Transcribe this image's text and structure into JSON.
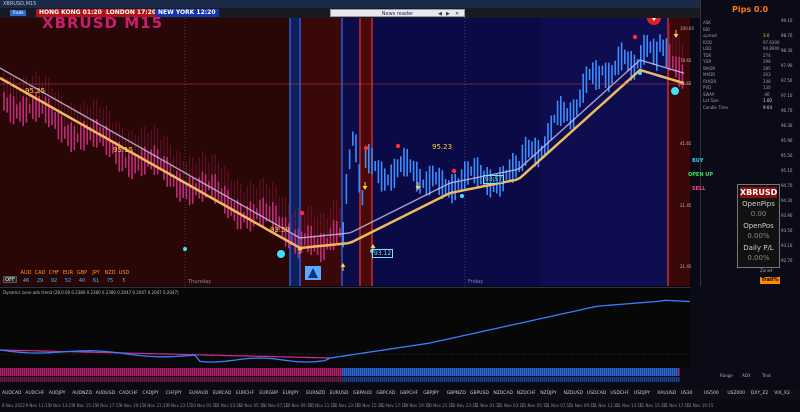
{
  "window": {
    "title": "XBRUSD,M15"
  },
  "toolbar": {
    "sessions": [
      {
        "label": "HONG KONG 01:20",
        "color": "#c41a1a"
      },
      {
        "label": "LONDON  17:20",
        "color": "#c41a1a"
      },
      {
        "label": "NEW YORK  12:20",
        "color": "#1a3ac4"
      }
    ],
    "news_label": "News reader",
    "trade_label": "Trade"
  },
  "chart": {
    "symbol_title": "XBRUSD M15",
    "price_scale": [
      "100.65",
      "78.65",
      "61.65",
      "41.65",
      "21.45",
      "21.45",
      "41.45",
      "61.65"
    ],
    "right_scale": [
      "99.10",
      "98.70",
      "98.30",
      "97.90",
      "97.50",
      "97.10",
      "96.70",
      "96.30",
      "95.90",
      "95.50",
      "95.10",
      "94.70",
      "94.30",
      "93.90",
      "93.50",
      "93.10",
      "92.70"
    ],
    "levels": [
      {
        "label": "95.25"
      },
      {
        "label": "95.15"
      },
      {
        "label": "95.23"
      },
      {
        "label": "93.59"
      },
      {
        "label": "93.57"
      },
      {
        "label": "93.12"
      }
    ],
    "days": [
      "Thursday",
      "Friday"
    ],
    "logo_icon": "triangle-logo-icon"
  },
  "info_panel": {
    "pips": "Pips 0.0",
    "rows": [
      {
        "k": "ASK",
        "v": ""
      },
      {
        "k": "BID",
        "v": ""
      },
      {
        "k": "spread",
        "v": "3.0"
      },
      {
        "k": "ROD",
        "v": "97.6300"
      },
      {
        "k": "LOD",
        "v": "94.8900"
      },
      {
        "k": "TDR",
        "v": "274"
      },
      {
        "k": "YDR",
        "v": "296"
      },
      {
        "k": "WADR",
        "v": "285"
      },
      {
        "k": "MADR",
        "v": "263"
      },
      {
        "k": "RYADR",
        "v": "248"
      },
      {
        "k": "PVD",
        "v": "130"
      },
      {
        "k": "SWAP",
        "v": "-46"
      },
      {
        "k": "Lot Size",
        "v": "1.00"
      },
      {
        "k": "Candle Time",
        "v": "9:04"
      }
    ],
    "buy": "BUY",
    "open_up": "OPEN UP",
    "sell": "SELL",
    "panel": {
      "symbol": "XBRUSD",
      "open_pips_label": "OpenPips",
      "open_pips_value": "0.00",
      "open_pos_label": "OpenPos",
      "open_pos_value": "0.00%",
      "daily_pl_label": "Daily P/L",
      "daily_pl_value": "0.00%"
    },
    "zone_label": "Zone4",
    "trail_label": "Trail%"
  },
  "currency_strength": {
    "currencies": [
      "AUD",
      "CAD",
      "CHF",
      "EUR",
      "GBP",
      "JPY",
      "NZD",
      "USD"
    ],
    "values": [
      "46",
      "29",
      "92",
      "52",
      "40",
      "61",
      "75",
      "5"
    ],
    "off_label": "OFF"
  },
  "indicator": {
    "title": "Dynamic zone adx trend (28,0.00 0.2380 0.2380 0.2380 0.2047 0.2047 0.2047 0.2047)"
  },
  "strip_right": {
    "labels": [
      "Range",
      "ADX",
      "Trnd"
    ]
  },
  "tabs": [
    "AUDCAD",
    "AUDCHF",
    "AUDJPY",
    "AUDNZD",
    "AUDUSD",
    "CADCHF",
    "CADJPY",
    "CHFJPY",
    "EURAUD",
    "EURCAD",
    "EURCHF",
    "EURGBP",
    "EURJPY",
    "EURNZD",
    "EURUSD",
    "GBPAUD",
    "GBPCAD",
    "GBPCHF",
    "GBPJPY",
    "GBPNZD",
    "GBPUSD",
    "NZDCAD",
    "NZDCHF",
    "NZDJPY",
    "NZDUSD",
    "USDCAD",
    "USDCHF",
    "USDJPY",
    "XAUUSD",
    "US30",
    "US500",
    "US2000",
    "DXY_Z2",
    "VIX_X2"
  ],
  "time_axis": [
    "8 Nov 2022",
    "9 Nov 11:15",
    "9 Nov 13:15",
    "9 Nov 15:15",
    "9 Nov 17:15",
    "9 Nov 19:15",
    "9 Nov 21:15",
    "9 Nov 23:15",
    "10 Nov 01:15",
    "10 Nov 03:15",
    "10 Nov 05:15",
    "10 Nov 07:15",
    "10 Nov 09:15",
    "10 Nov 11:15",
    "10 Nov 13:15",
    "10 Nov 15:15",
    "10 Nov 17:15",
    "10 Nov 19:15",
    "10 Nov 21:15",
    "10 Nov 23:15",
    "11 Nov 01:15",
    "11 Nov 03:15",
    "11 Nov 05:15",
    "11 Nov 07:15",
    "11 Nov 09:15",
    "11 Nov 11:15",
    "11 Nov 13:15",
    "11 Nov 15:15",
    "11 Nov 17:15",
    "11 Nov 19:15"
  ],
  "colors": {
    "buy": "#3fc8ff",
    "sell": "#ff4488",
    "accent": "#ff7a1a",
    "bull_zone": "#0a0a4a",
    "bear_zone": "#3a0808"
  }
}
